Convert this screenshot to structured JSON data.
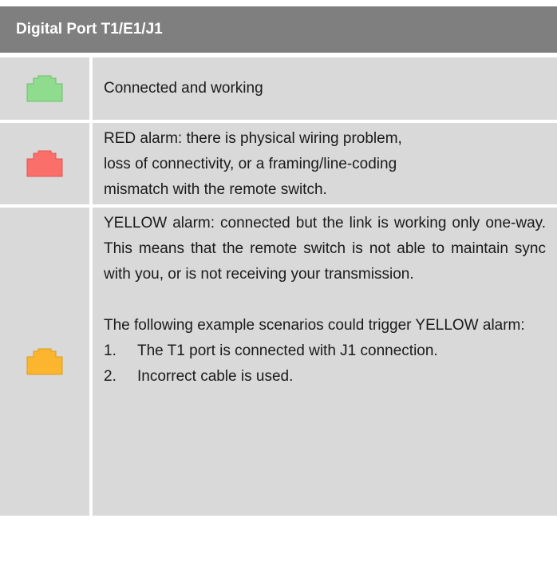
{
  "header": {
    "title": "Digital Port T1/E1/J1"
  },
  "colors": {
    "header_bg": "#7f7f7f",
    "row_bg": "#d9d9d9",
    "green_port": "#8fdc8f",
    "red_port": "#fb6f6a",
    "yellow_port": "#fcb52e"
  },
  "rows": [
    {
      "icon": "green-port-icon",
      "text": "Connected and working"
    },
    {
      "icon": "red-port-icon",
      "lines": [
        "RED alarm: there is physical wiring problem,",
        "loss of connectivity, or a framing/line-coding",
        "mismatch with the remote switch."
      ]
    },
    {
      "icon": "yellow-port-icon",
      "paragraph1": "YELLOW alarm: connected but the link is working only one-way. This means that the remote switch is not able to maintain sync with you, or is not receiving your transmission.",
      "paragraph2": "The following example scenarios could trigger YELLOW alarm:",
      "scenarios": [
        {
          "number": "1.",
          "text": "The T1 port is connected with J1 connection."
        },
        {
          "number": "2.",
          "text": "Incorrect cable is used."
        }
      ]
    }
  ]
}
